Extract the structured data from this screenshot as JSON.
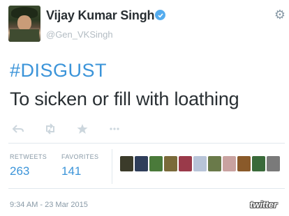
{
  "author": {
    "name": "Vijay Kumar Singh",
    "handle": "@Gen_VKSingh",
    "verified": true
  },
  "tweet": {
    "hashtag": "#DISGUST",
    "text": "To sicken or fill with loathing"
  },
  "actions": [
    {
      "name": "reply-icon"
    },
    {
      "name": "retweet-icon"
    },
    {
      "name": "favorite-icon"
    },
    {
      "name": "more-icon"
    }
  ],
  "stats": {
    "retweets_label": "RETWEETS",
    "retweets_value": "263",
    "favorites_label": "FAVORITES",
    "favorites_value": "141"
  },
  "favoriters_colors": [
    "#3b3b2a",
    "#2f3e5a",
    "#4a7a3a",
    "#7a6a3a",
    "#9a3a4a",
    "#b8c4d8",
    "#6a7a4a",
    "#c9a2a0",
    "#8a5a2a",
    "#3a6a3a",
    "#7a7a7a"
  ],
  "footer": {
    "timestamp": "9:34 AM - 23 Mar 2015",
    "brand": "twitter"
  },
  "colors": {
    "link": "#3b94d9",
    "verified": "#55acee",
    "muted": "#8899a6"
  }
}
